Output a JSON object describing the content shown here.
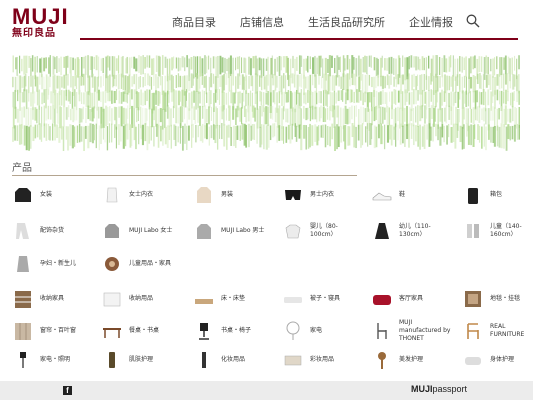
{
  "brand": {
    "logo_text": "MUJI",
    "logo_sub": "無印良品",
    "color": "#7f0019"
  },
  "nav": {
    "items": [
      "商品目录",
      "店铺信息",
      "生活良品研究所",
      "企业情报"
    ],
    "search_icon": "search-icon"
  },
  "section": {
    "title": "产品"
  },
  "categories": [
    [
      {
        "label": "女装",
        "icon": "sweater-icon"
      },
      {
        "label": "女士内衣",
        "icon": "camisole-icon"
      },
      {
        "label": "男装",
        "icon": "shirt-icon"
      },
      {
        "label": "男士内衣",
        "icon": "underwear-icon"
      },
      {
        "label": "鞋",
        "icon": "sneaker-icon"
      },
      {
        "label": "箱包",
        "icon": "suitcase-icon"
      }
    ],
    [
      {
        "label": "配饰杂货",
        "icon": "scarf-icon"
      },
      {
        "label": "MUJI Labo 女士",
        "icon": "labo-women-icon"
      },
      {
        "label": "MUJI Labo 男士",
        "icon": "labo-men-icon"
      },
      {
        "label": "婴儿（80-\n100cm）",
        "icon": "baby-clothes-icon"
      },
      {
        "label": "幼儿（110-\n130cm）",
        "icon": "kids-dress-icon"
      },
      {
        "label": "儿童（140-\n160cm）",
        "icon": "kids-socks-icon"
      }
    ],
    [
      {
        "label": "孕妇・新生儿",
        "icon": "maternity-icon"
      },
      {
        "label": "儿童用品・家具",
        "icon": "toy-icon"
      }
    ],
    [
      {
        "label": "收纳家具",
        "icon": "shelf-icon"
      },
      {
        "label": "收纳用品",
        "icon": "storage-box-icon"
      },
      {
        "label": "床・床垫",
        "icon": "bed-icon"
      },
      {
        "label": "被子・寝具",
        "icon": "bedding-icon"
      },
      {
        "label": "客厅家具",
        "icon": "sofa-icon"
      },
      {
        "label": "地毯・挂毯",
        "icon": "rug-icon"
      }
    ],
    [
      {
        "label": "窗帘・百叶窗",
        "icon": "curtain-icon"
      },
      {
        "label": "餐桌・书桌",
        "icon": "table-icon"
      },
      {
        "label": "书桌・椅子",
        "icon": "chair-icon"
      },
      {
        "label": "家电",
        "icon": "fan-icon"
      },
      {
        "label": "MUJI\nmanufactured by\nTHONET",
        "icon": "thonet-chair-icon"
      },
      {
        "label": "REAL\nFURNITURE",
        "icon": "wood-chair-icon"
      }
    ],
    [
      {
        "label": "家电・照明",
        "icon": "lamp-icon"
      },
      {
        "label": "肌肤护理",
        "icon": "skincare-icon"
      },
      {
        "label": "化妆用品",
        "icon": "cosmetics-icon"
      },
      {
        "label": "彩妆用品",
        "icon": "makeup-icon"
      },
      {
        "label": "美发护理",
        "icon": "hairbrush-icon"
      },
      {
        "label": "身体护理",
        "icon": "bodycare-icon"
      }
    ]
  ],
  "footer": {
    "social_icon": "facebook-icon",
    "fb_glyph": "f",
    "passport_brand": "MUJI",
    "passport_text": "passport",
    "bg": "#ececec"
  }
}
